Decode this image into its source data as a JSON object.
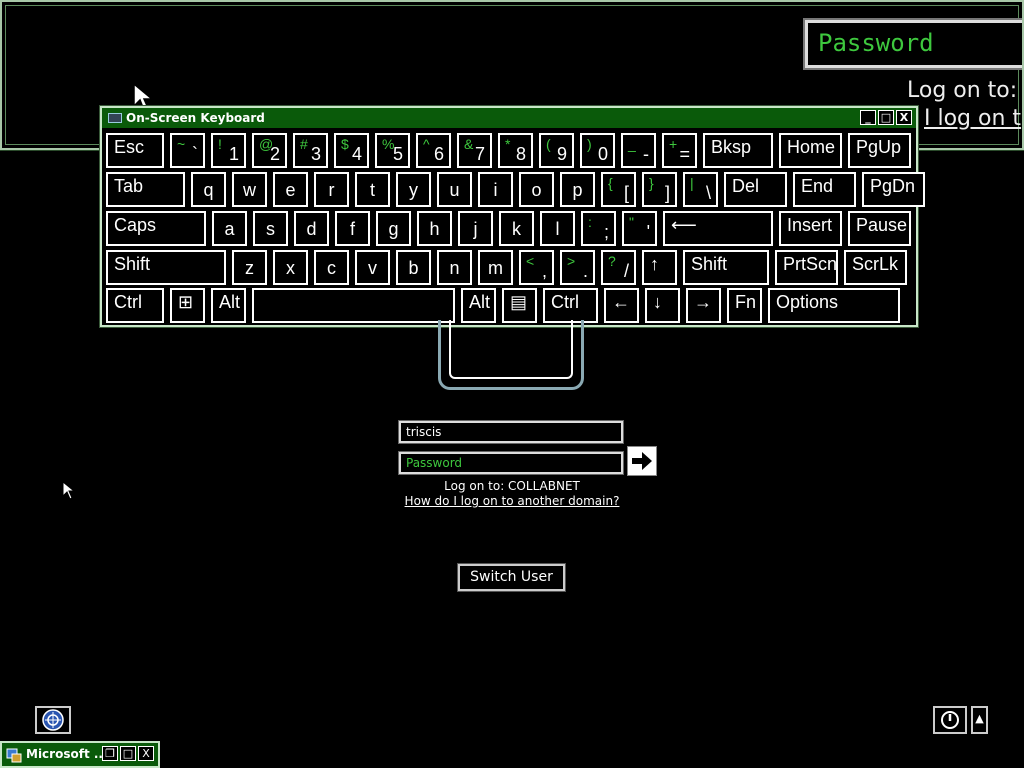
{
  "magnifier": {
    "password_text": "Password",
    "logon_text": "Log on to:",
    "link_text": "I log on t"
  },
  "osk": {
    "title": "On-Screen Keyboard",
    "window_buttons": {
      "minimize": "_",
      "restore": "□",
      "close": "X"
    },
    "rows": [
      [
        {
          "label": "Esc"
        },
        {
          "shift": "~",
          "base": "`"
        },
        {
          "shift": "!",
          "base": "1"
        },
        {
          "shift": "@",
          "base": "2"
        },
        {
          "shift": "#",
          "base": "3"
        },
        {
          "shift": "$",
          "base": "4"
        },
        {
          "shift": "%",
          "base": "5"
        },
        {
          "shift": "^",
          "base": "6"
        },
        {
          "shift": "&",
          "base": "7"
        },
        {
          "shift": "*",
          "base": "8"
        },
        {
          "shift": "(",
          "base": "9"
        },
        {
          "shift": ")",
          "base": "0"
        },
        {
          "shift": "_",
          "base": "-"
        },
        {
          "shift": "+",
          "base": "="
        },
        {
          "label": "Bksp"
        },
        {
          "label": "Home"
        },
        {
          "label": "PgUp"
        }
      ],
      [
        {
          "label": "Tab"
        },
        {
          "center": "q"
        },
        {
          "center": "w"
        },
        {
          "center": "e"
        },
        {
          "center": "r"
        },
        {
          "center": "t"
        },
        {
          "center": "y"
        },
        {
          "center": "u"
        },
        {
          "center": "i"
        },
        {
          "center": "o"
        },
        {
          "center": "p"
        },
        {
          "shift": "{",
          "base": "["
        },
        {
          "shift": "}",
          "base": "]"
        },
        {
          "shift": "|",
          "base": "\\"
        },
        {
          "label": "Del"
        },
        {
          "label": "End"
        },
        {
          "label": "PgDn"
        }
      ],
      [
        {
          "label": "Caps"
        },
        {
          "center": "a"
        },
        {
          "center": "s"
        },
        {
          "center": "d"
        },
        {
          "center": "f"
        },
        {
          "center": "g"
        },
        {
          "center": "h"
        },
        {
          "center": "j"
        },
        {
          "center": "k"
        },
        {
          "center": "l"
        },
        {
          "shift": ":",
          "base": ";"
        },
        {
          "shift": "\"",
          "base": "'"
        },
        {
          "label": "⟵"
        },
        {
          "label": "Insert"
        },
        {
          "label": "Pause"
        }
      ],
      [
        {
          "label": "Shift"
        },
        {
          "center": "z"
        },
        {
          "center": "x"
        },
        {
          "center": "c"
        },
        {
          "center": "v"
        },
        {
          "center": "b"
        },
        {
          "center": "n"
        },
        {
          "center": "m"
        },
        {
          "shift": "<",
          "base": ","
        },
        {
          "shift": ">",
          "base": "."
        },
        {
          "shift": "?",
          "base": "/"
        },
        {
          "label": "↑"
        },
        {
          "label": "Shift"
        },
        {
          "label": "PrtScn"
        },
        {
          "label": "ScrLk"
        }
      ],
      [
        {
          "label": "Ctrl"
        },
        {
          "label": "⊞"
        },
        {
          "label": "Alt"
        },
        {
          "label": ""
        },
        {
          "label": "Alt"
        },
        {
          "label": "▤"
        },
        {
          "label": "Ctrl"
        },
        {
          "label": "←"
        },
        {
          "label": "↓"
        },
        {
          "label": "→"
        },
        {
          "label": "Fn"
        },
        {
          "label": "Options"
        }
      ]
    ]
  },
  "login": {
    "username_value": "triscis",
    "password_placeholder": "Password",
    "logon_to": "Log on to: COLLABNET",
    "domain_link": "How do I log on to another domain?",
    "switch_user": "Switch User"
  },
  "bottom": {
    "power_menu_arrow": "▲"
  },
  "taskbar_window": {
    "title": "Microsoft ...",
    "buttons": {
      "restore": "❐",
      "maximize": "□",
      "close": "X"
    }
  }
}
